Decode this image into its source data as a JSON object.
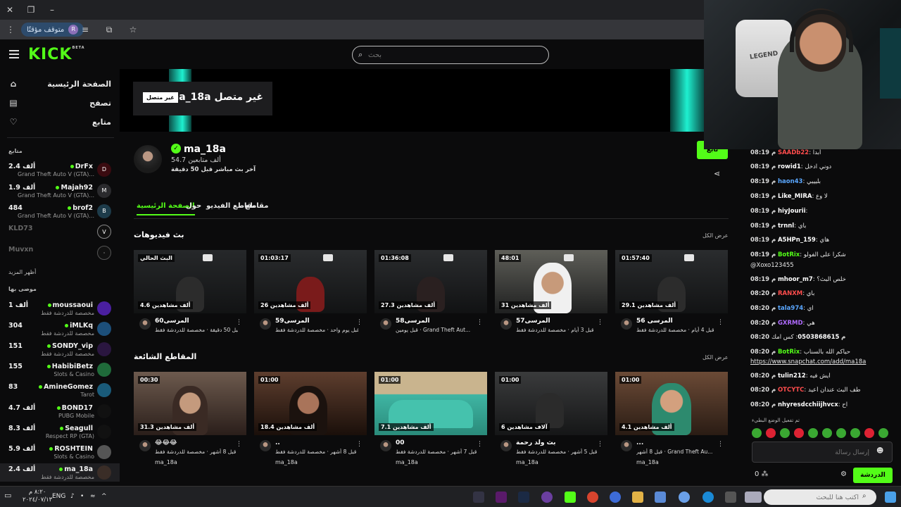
{
  "browser": {
    "paused_label": "متوقف مؤقتًا",
    "profile_initial": "R"
  },
  "header": {
    "logo": "KICK",
    "logo_beta": "BETA",
    "search_placeholder": "بحث"
  },
  "sidebar": {
    "nav": [
      {
        "label": "الصفحة الرئيسية",
        "icon": "home-icon"
      },
      {
        "label": "تصفح",
        "icon": "browse-icon"
      },
      {
        "label": "متابع",
        "icon": "heart-icon"
      }
    ],
    "following_title": "متابع",
    "following": [
      {
        "name": "DrFx",
        "viewers": "2.4 ألف",
        "category": "Grand Theft Auto V (GTA)...",
        "avatar": "D"
      },
      {
        "name": "Majah92",
        "viewers": "1.9 ألف",
        "category": "Grand Theft Auto V (GTA)...",
        "avatar": "M"
      },
      {
        "name": "brof2",
        "viewers": "484",
        "category": "Grand Theft Auto V (GTA)...",
        "avatar": "B"
      },
      {
        "name": "KLD73",
        "viewers": "",
        "category": "",
        "avatar": "V",
        "offline": true
      },
      {
        "name": "Muvxn",
        "viewers": "",
        "category": "",
        "avatar": "·",
        "offline": true
      }
    ],
    "show_more": "أظهر المزيد",
    "recommended_title": "موصى بها",
    "recommended": [
      {
        "name": "moussaoui",
        "viewers": "1 ألف",
        "category": "مخصصة للدردشة فقط"
      },
      {
        "name": "iMLKq",
        "viewers": "304",
        "category": "مخصصة للدردشة فقط"
      },
      {
        "name": "SONDY_vip",
        "viewers": "151",
        "category": "مخصصة للدردشة فقط"
      },
      {
        "name": "HabibiBetz",
        "viewers": "155",
        "category": "Slots & Casino"
      },
      {
        "name": "AmineGomez",
        "viewers": "83",
        "category": "Tarot"
      },
      {
        "name": "BOND17",
        "viewers": "4.7 ألف",
        "category": "PUBG Mobile"
      },
      {
        "name": "Seagull",
        "viewers": "8.3 ألف",
        "category": "Respect RP (GTA)"
      },
      {
        "name": "ROSHTEIN",
        "viewers": "5.9 ألف",
        "category": "Slots & Casino"
      },
      {
        "name": "ma_18a",
        "viewers": "2.4 ألف",
        "category": "مخصصة للدردشة فقط"
      }
    ]
  },
  "channel": {
    "offline_title": "ma_18a غير متصل",
    "offline_badge": "غير متصل",
    "name": "ma_18a",
    "followers": "54.7 ألف متابعين",
    "last_live": "آخر بث مباشر قبل 50 دقيقة",
    "follow_label": "تابع",
    "tabs": [
      "الصفحة الرئيسية",
      "حول",
      "مقاطع الفيديو",
      "مقاطع"
    ],
    "videos_title": "بث فيديوهات",
    "clips_title": "المقاطع الشائعة",
    "view_all": "عرض الكل",
    "videos": [
      {
        "duration": "البث الحالي",
        "views": "4.6 ألف مشاهدين",
        "title": "المرسى60",
        "meta": "قبل 50 دقيقة · مخصصة للدردشة فقط"
      },
      {
        "duration": "01:03:17",
        "views": "26 ألف مشاهدين",
        "title": "المرسى59",
        "meta": "قبل يوم واحد · مخصصة للدردشة فقط"
      },
      {
        "duration": "01:36:08",
        "views": "27.3 ألف مشاهدين",
        "title": "المرسى58",
        "meta": "قبل يومين · Grand Theft Aut..."
      },
      {
        "duration": "48:01",
        "views": "31 ألف مشاهدين",
        "title": "المرسى57",
        "meta": "قبل 3 أيام · مخصصة للدردشة فقط"
      },
      {
        "duration": "01:57:40",
        "views": "29.1 ألف مشاهدين",
        "title": "المرسى 56",
        "meta": "قبل 4 أيام · مخصصة للدردشة فقط"
      }
    ],
    "clips": [
      {
        "duration": "00:30",
        "views": "31.3 ألف مشاهدين",
        "title": "😂😂😂",
        "meta": "قبل 8 أشهر · مخصصة للدردشة فقط",
        "user": "ma_18a"
      },
      {
        "duration": "01:00",
        "views": "18.4 ألف مشاهدين",
        "title": "..",
        "meta": "قبل 8 أشهر · مخصصة للدردشة فقط",
        "user": "ma_18a"
      },
      {
        "duration": "01:00",
        "views": "7.1 ألف مشاهدين",
        "title": "00",
        "meta": "قبل 7 أشهر · مخصصة للدردشة فقط",
        "user": "ma_18a"
      },
      {
        "duration": "01:00",
        "views": "6 آلاف مشاهدين",
        "title": "بث ولد رحمة",
        "meta": "قبل 5 أشهر · مخصصة للدردشة فقط",
        "user": "ma_18a"
      },
      {
        "duration": "01:00",
        "views": "4.1 ألف مشاهدين",
        "title": "...",
        "meta": "قبل 8 أشهر · Grand Theft Au...",
        "user": "ma_18a"
      }
    ]
  },
  "chat": {
    "messages": [
      {
        "time": "08:19 م",
        "user": "SAADb22",
        "color": "#ff4d4d",
        "text": "أبدا"
      },
      {
        "time": "08:19 م",
        "user": "rowid1",
        "color": "#ffffff",
        "text": "دوني ادخل"
      },
      {
        "time": "08:19 م",
        "user": "haon43",
        "color": "#5aa7ff",
        "text": "بليييي"
      },
      {
        "time": "08:19 م",
        "user": "Like_MIRA",
        "color": "#ffffff",
        "text": "لا وع"
      },
      {
        "time": "08:19 م",
        "user": "hiyJourii",
        "color": "#ffffff",
        "text": ""
      },
      {
        "time": "08:19 م",
        "user": "trnnl",
        "color": "#ffffff",
        "text": "باي"
      },
      {
        "time": "08:19 م",
        "user": "A5HPn_159",
        "color": "#ffffff",
        "text": "هاي"
      },
      {
        "time": "08:19 م",
        "user": "BotRix",
        "color": "#53fc18",
        "text": "شكرا على الفولو"
      },
      {
        "time": "",
        "user": "",
        "color": "#ffffff",
        "text": "@Xoxo123455"
      },
      {
        "time": "08:19 م",
        "user": "mhoor_m7",
        "color": "#ffffff",
        "text": "خلص البث؟"
      },
      {
        "time": "08:20 م",
        "user": "RANXM",
        "color": "#ff4d4d",
        "text": "باي"
      },
      {
        "time": "08:20 م",
        "user": "tala974",
        "color": "#5aa7ff",
        "text": "اي"
      },
      {
        "time": "08:20 م",
        "user": "GXRMD",
        "color": "#b06bff",
        "text": "هي"
      },
      {
        "time": "08:20 م",
        "user": "0503868615",
        "color": "#ffffff",
        "text": "كس امك"
      },
      {
        "time": "08:20 م",
        "user": "BotRix",
        "color": "#53fc18",
        "text": "حياكم الله بالسناب"
      },
      {
        "time": "",
        "user": "",
        "color": "#ffffff",
        "text": "https://www.snapchat.com/add/ma18a"
      },
      {
        "time": "08:20 م",
        "user": "tulin212",
        "color": "#ffffff",
        "text": "ايش فيه"
      },
      {
        "time": "08:20 م",
        "user": "OTCYTC",
        "color": "#ff4d4d",
        "text": "طف البث عندان أعيد"
      },
      {
        "time": "08:20 م",
        "user": "nhyresdcchiijhvcx",
        "color": "#ffffff",
        "text": "اح"
      }
    ],
    "note": "تم تفعيل الوضع البطيء",
    "placeholder": "إرسال رسالة",
    "send_label": "الدردشة",
    "count": "0"
  },
  "taskbar": {
    "time": "٨:٢٠ م",
    "date": "٢٠٢٤/٠٧/١٣",
    "lang": "ENG",
    "search_placeholder": "اكتب هنا للبحث"
  }
}
